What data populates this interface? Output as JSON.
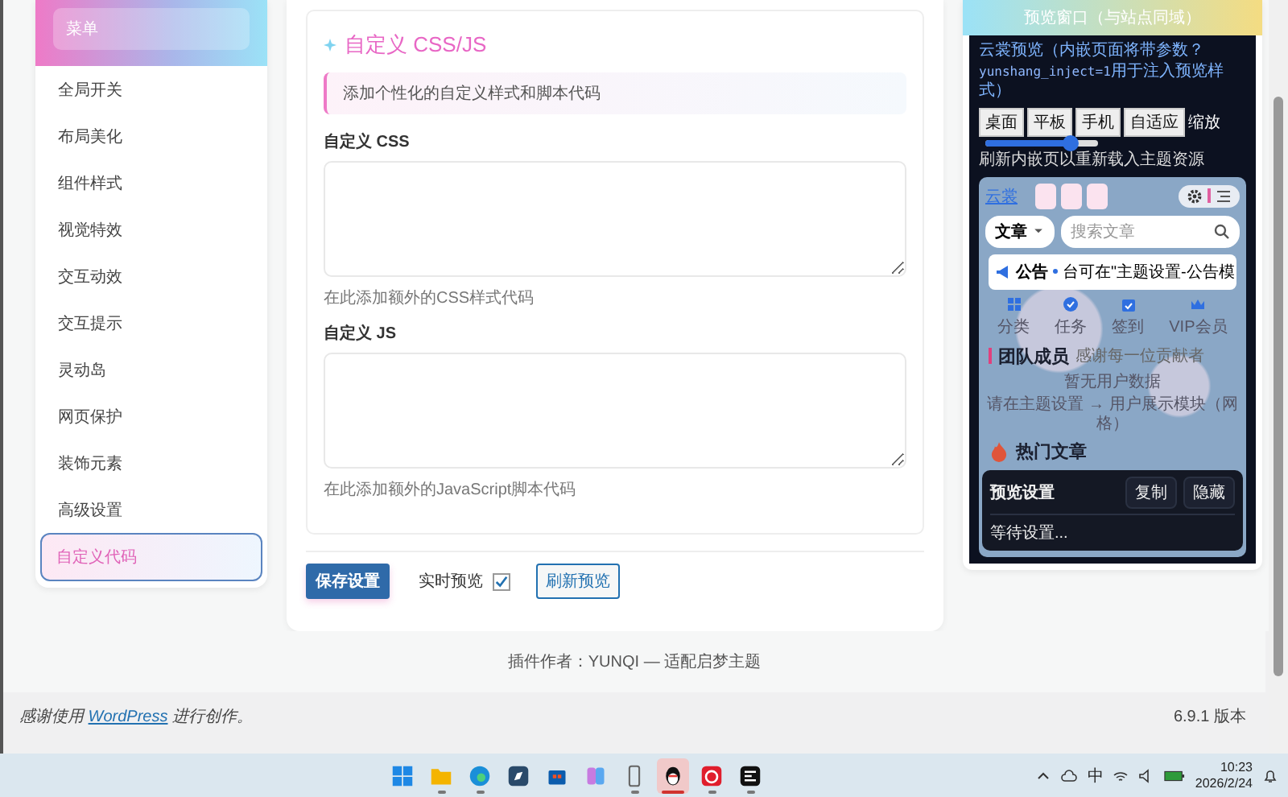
{
  "sidebar": {
    "title": "菜单",
    "items": [
      {
        "label": "全局开关",
        "selected": false
      },
      {
        "label": "布局美化",
        "selected": false
      },
      {
        "label": "组件样式",
        "selected": false
      },
      {
        "label": "视觉特效",
        "selected": false
      },
      {
        "label": "交互动效",
        "selected": false
      },
      {
        "label": "交互提示",
        "selected": false
      },
      {
        "label": "灵动岛",
        "selected": false
      },
      {
        "label": "网页保护",
        "selected": false
      },
      {
        "label": "装饰元素",
        "selected": false
      },
      {
        "label": "高级设置",
        "selected": false
      },
      {
        "label": "自定义代码",
        "selected": true
      }
    ]
  },
  "main": {
    "title": "自定义 CSS/JS",
    "notice": "添加个性化的自定义样式和脚本代码",
    "fields": [
      {
        "label": "自定义 CSS",
        "hint": "在此添加额外的CSS样式代码"
      },
      {
        "label": "自定义 JS",
        "hint": "在此添加额外的JavaScript脚本代码"
      }
    ],
    "save_button": "保存设置",
    "live_preview": {
      "label": "实时预览",
      "checked": true
    },
    "refresh_button": "刷新预览"
  },
  "credit": "插件作者：YUNQI — 适配启梦主题",
  "preview": {
    "title": "预览窗口（与站点同域）",
    "description_before": "云裳预览（内嵌页面将带参数？",
    "description_code": "yunshang_inject=1",
    "description_after": "用于注入预览样式）",
    "devices": [
      {
        "label": "桌面"
      },
      {
        "label": "平板"
      },
      {
        "label": "手机"
      },
      {
        "label": "自适应"
      }
    ],
    "zoom_label": "缩放",
    "zoom": {
      "level": 0.75
    },
    "refresh_hint": "刷新内嵌页以重新载入主题资源",
    "site": {
      "logo_alt": "云裳",
      "category_select": "文章",
      "search_placeholder": "搜索文章",
      "notice_label": "公告",
      "notice_text": "台可在\"主题设置-公告模",
      "nav": [
        {
          "kind": "grid",
          "label": "分类"
        },
        {
          "kind": "check",
          "label": "任务"
        },
        {
          "kind": "calendar",
          "label": "签到"
        },
        {
          "kind": "crown",
          "label": "VIP会员"
        }
      ],
      "section_title": "团队成员",
      "section_subtitle": "感谢每一位贡献者",
      "empty_text": "暂无用户数据",
      "empty_hint": "请在主题设置 → 用户展示模块（网格）",
      "next_section": "热门文章"
    },
    "overlay": {
      "title": "预览设置",
      "buttons": [
        "复制",
        "隐藏"
      ],
      "status": "等待设置..."
    }
  },
  "wp_footer": {
    "link": "WordPress",
    "before": "感谢使用 ",
    "after": " 进行创作。",
    "version": "6.9.1 版本"
  },
  "taskbar": {
    "apps": [
      {
        "kind": "start",
        "running": false,
        "selected": false
      },
      {
        "kind": "folder",
        "running": true,
        "selected": false
      },
      {
        "kind": "browser",
        "running": true,
        "selected": false
      },
      {
        "kind": "compass",
        "running": false,
        "selected": false
      },
      {
        "kind": "store",
        "running": false,
        "selected": false
      },
      {
        "kind": "tiles",
        "running": false,
        "selected": false
      },
      {
        "kind": "phone",
        "running": true,
        "selected": false
      },
      {
        "kind": "penguin",
        "running": true,
        "selected": true
      },
      {
        "kind": "music",
        "running": true,
        "selected": false
      },
      {
        "kind": "app",
        "running": true,
        "selected": false
      }
    ],
    "input_method": "中",
    "time": "10:23",
    "date": "2026/2/24"
  }
}
